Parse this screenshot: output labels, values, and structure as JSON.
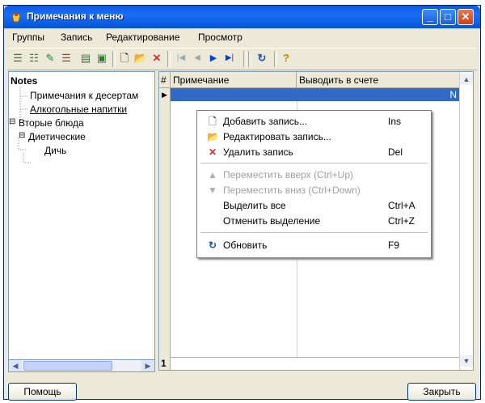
{
  "window": {
    "title": "Примечания к меню"
  },
  "menubar": {
    "items": [
      "Группы",
      "Запись",
      "Редактирование",
      "Просмотр"
    ]
  },
  "toolbar": {
    "icons": [
      "add-group-icon",
      "add-subgroup-icon",
      "edit-group-icon",
      "delete-group-icon",
      "move-group-icon",
      "refresh-group-icon",
      "new-record-icon",
      "open-record-icon",
      "delete-record-icon",
      "first-record-icon",
      "prev-record-icon",
      "next-record-icon",
      "last-record-icon",
      "refresh-icon",
      "help-icon"
    ]
  },
  "tree": {
    "root": "Notes",
    "items": [
      "Примечания к десертам",
      "Алкогольные напитки",
      "Вторые блюда",
      "Диетические",
      "Дичь"
    ]
  },
  "grid": {
    "columns": [
      "#",
      "Примечание",
      "Выводить в счете"
    ],
    "selected_row_value": "N",
    "footer_count": "1"
  },
  "context_menu": {
    "items": [
      {
        "label": "Добавить запись...",
        "shortcut": "Ins",
        "icon": "new-record-icon",
        "enabled": true
      },
      {
        "label": "Редактировать запись...",
        "shortcut": "",
        "icon": "open-folder-icon",
        "enabled": true
      },
      {
        "label": "Удалить запись",
        "shortcut": "Del",
        "icon": "delete-icon",
        "enabled": true
      },
      {
        "label": "Переместить вверх (Ctrl+Up)",
        "shortcut": "",
        "icon": "move-up-icon",
        "enabled": false
      },
      {
        "label": "Переместить вниз (Ctrl+Down)",
        "shortcut": "",
        "icon": "move-down-icon",
        "enabled": false
      },
      {
        "label": "Выделить все",
        "shortcut": "Ctrl+A",
        "icon": "",
        "enabled": true
      },
      {
        "label": "Отменить выделение",
        "shortcut": "Ctrl+Z",
        "icon": "",
        "enabled": true
      },
      {
        "label": "Обновить",
        "shortcut": "F9",
        "icon": "refresh-icon",
        "enabled": true
      }
    ]
  },
  "buttons": {
    "help": "Помощь",
    "close": "Закрыть"
  },
  "colors": {
    "title_bar": "#0a5ae3",
    "selection": "#316ac5",
    "face": "#ece9d8"
  }
}
